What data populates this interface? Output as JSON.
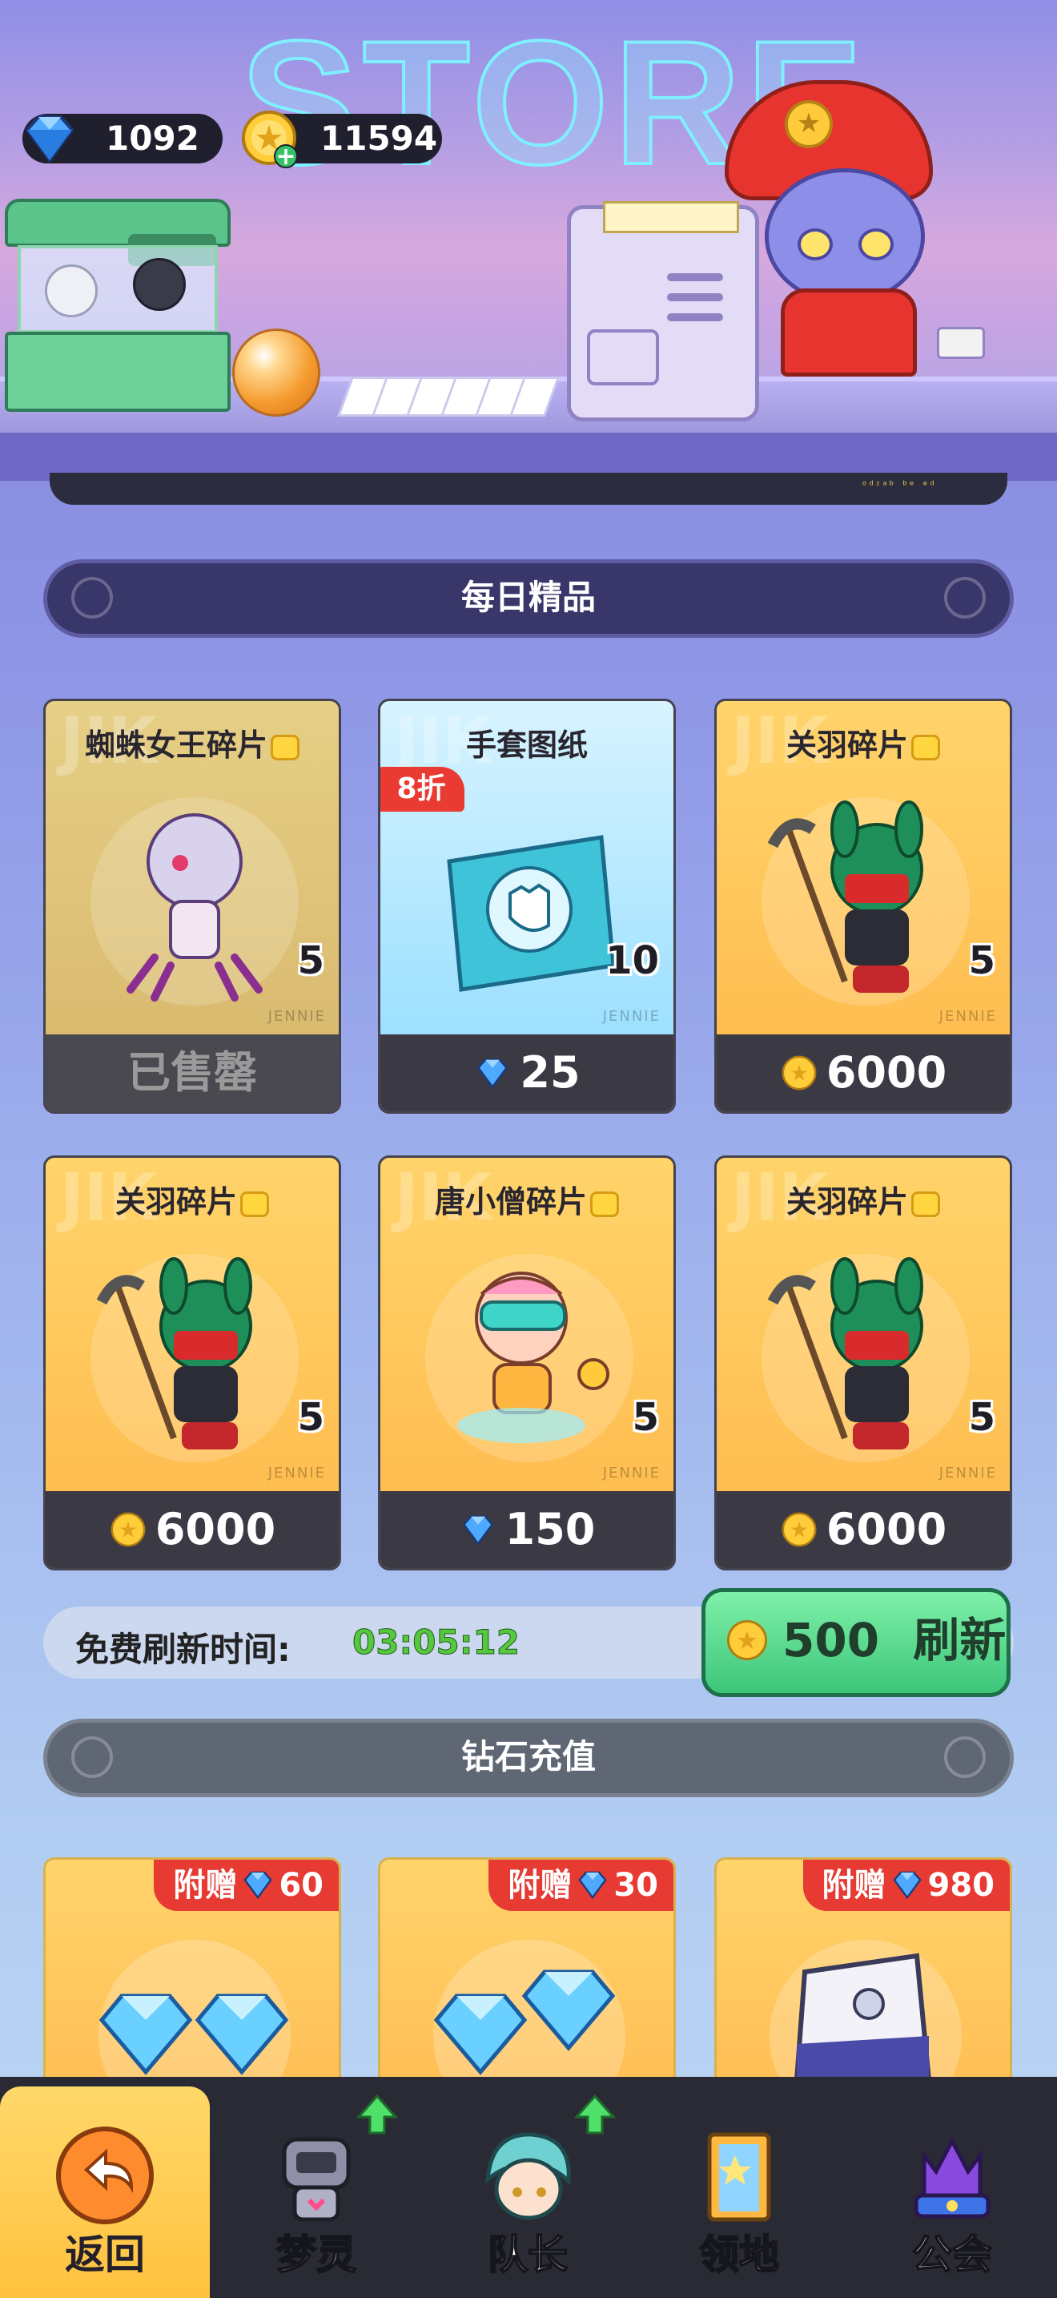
{
  "header": {
    "store_title": "STORE",
    "gems": "1092",
    "coins": "11594",
    "strip_text": "ᵒᵈᶦᵃᵇ ᵇᵉ ᵉᵈ"
  },
  "daily": {
    "title": "每日精品",
    "cards": [
      {
        "name": "蜘蛛女王碎片",
        "qty": "5",
        "price": "已售罄",
        "currency": "none",
        "discount": ""
      },
      {
        "name": "手套图纸",
        "qty": "10",
        "price": "25",
        "currency": "gem",
        "discount": "8折"
      },
      {
        "name": "关羽碎片",
        "qty": "5",
        "price": "6000",
        "currency": "coin",
        "discount": ""
      },
      {
        "name": "关羽碎片",
        "qty": "5",
        "price": "6000",
        "currency": "coin",
        "discount": ""
      },
      {
        "name": "唐小僧碎片",
        "qty": "5",
        "price": "150",
        "currency": "gem",
        "discount": ""
      },
      {
        "name": "关羽碎片",
        "qty": "5",
        "price": "6000",
        "currency": "coin",
        "discount": ""
      }
    ],
    "card_watermark": "JIK",
    "card_brand": "JENNIE"
  },
  "refresh": {
    "label": "免费刷新时间:",
    "time": "03:05:12",
    "cost": "500",
    "button_label": "刷新"
  },
  "recharge": {
    "title": "钻石充值",
    "bonus_prefix": "附赠",
    "items": [
      {
        "bonus": "60"
      },
      {
        "bonus": "30"
      },
      {
        "bonus": "980"
      }
    ]
  },
  "nav": [
    {
      "label": "返回",
      "icon": "back-arrow-icon",
      "active": true
    },
    {
      "label": "梦灵",
      "icon": "robot-icon",
      "badge": "upgrade-arrow"
    },
    {
      "label": "队长",
      "icon": "captain-avatar-icon",
      "badge": "upgrade-arrow"
    },
    {
      "label": "领地",
      "icon": "territory-door-icon"
    },
    {
      "label": "公会",
      "icon": "guild-crown-icon"
    }
  ],
  "colors": {
    "accent_green": "#3cc67a",
    "timer_green": "#56c83f",
    "discount_red": "#ea3b33",
    "panel_dark": "#3a3944"
  }
}
